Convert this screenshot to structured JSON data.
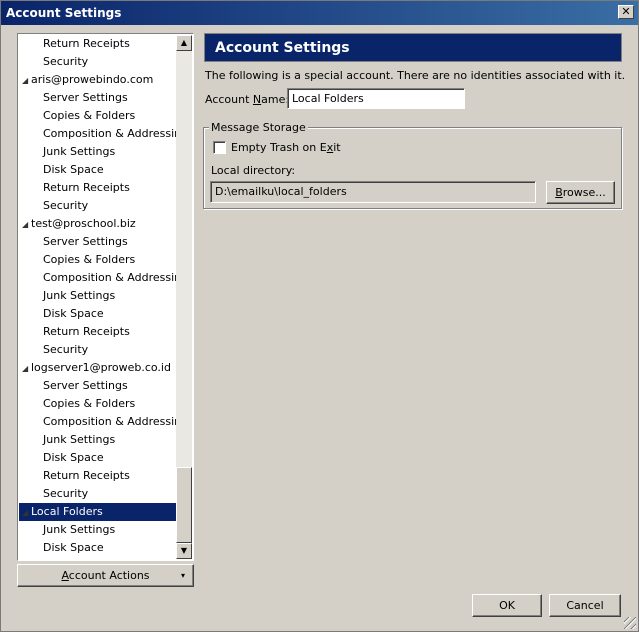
{
  "window": {
    "title": "Account Settings",
    "close_glyph": "✕"
  },
  "tree": {
    "rows": [
      {
        "label": "Return Receipts",
        "type": "child"
      },
      {
        "label": "Security",
        "type": "child"
      },
      {
        "label": "aris@prowebindo.com",
        "type": "account"
      },
      {
        "label": "Server Settings",
        "type": "child"
      },
      {
        "label": "Copies & Folders",
        "type": "child"
      },
      {
        "label": "Composition & Addressing",
        "type": "child"
      },
      {
        "label": "Junk Settings",
        "type": "child"
      },
      {
        "label": "Disk Space",
        "type": "child"
      },
      {
        "label": "Return Receipts",
        "type": "child"
      },
      {
        "label": "Security",
        "type": "child"
      },
      {
        "label": "test@proschool.biz",
        "type": "account"
      },
      {
        "label": "Server Settings",
        "type": "child"
      },
      {
        "label": "Copies & Folders",
        "type": "child"
      },
      {
        "label": "Composition & Addressing",
        "type": "child"
      },
      {
        "label": "Junk Settings",
        "type": "child"
      },
      {
        "label": "Disk Space",
        "type": "child"
      },
      {
        "label": "Return Receipts",
        "type": "child"
      },
      {
        "label": "Security",
        "type": "child"
      },
      {
        "label": "logserver1@proweb.co.id",
        "type": "account"
      },
      {
        "label": "Server Settings",
        "type": "child"
      },
      {
        "label": "Copies & Folders",
        "type": "child"
      },
      {
        "label": "Composition & Addressing",
        "type": "child"
      },
      {
        "label": "Junk Settings",
        "type": "child"
      },
      {
        "label": "Disk Space",
        "type": "child"
      },
      {
        "label": "Return Receipts",
        "type": "child"
      },
      {
        "label": "Security",
        "type": "child"
      },
      {
        "label": "Local Folders",
        "type": "account-selected"
      },
      {
        "label": "Junk Settings",
        "type": "child"
      },
      {
        "label": "Disk Space",
        "type": "child"
      }
    ],
    "expand_glyph": "◢",
    "scroll_up_glyph": "▲",
    "scroll_down_glyph": "▼"
  },
  "account_actions": {
    "label_pre": "",
    "label_underline": "A",
    "label_post": "ccount Actions",
    "arrow": "▾"
  },
  "panel": {
    "header": "Account Settings",
    "info": "The following is a special account. There are no identities associated with it.",
    "account_name_label_pre": "Account ",
    "account_name_label_underline": "N",
    "account_name_label_post": "ame:",
    "account_name_value": "Local Folders",
    "message_storage_legend": "Message Storage",
    "empty_trash_pre": "Empty Trash on E",
    "empty_trash_underline": "x",
    "empty_trash_post": "it",
    "empty_trash_checked": false,
    "local_directory_label": "Local directory:",
    "local_directory_value": "D:\\emailku\\local_folders",
    "browse_pre": "",
    "browse_underline": "B",
    "browse_post": "rowse..."
  },
  "footer": {
    "ok": "OK",
    "cancel": "Cancel"
  }
}
